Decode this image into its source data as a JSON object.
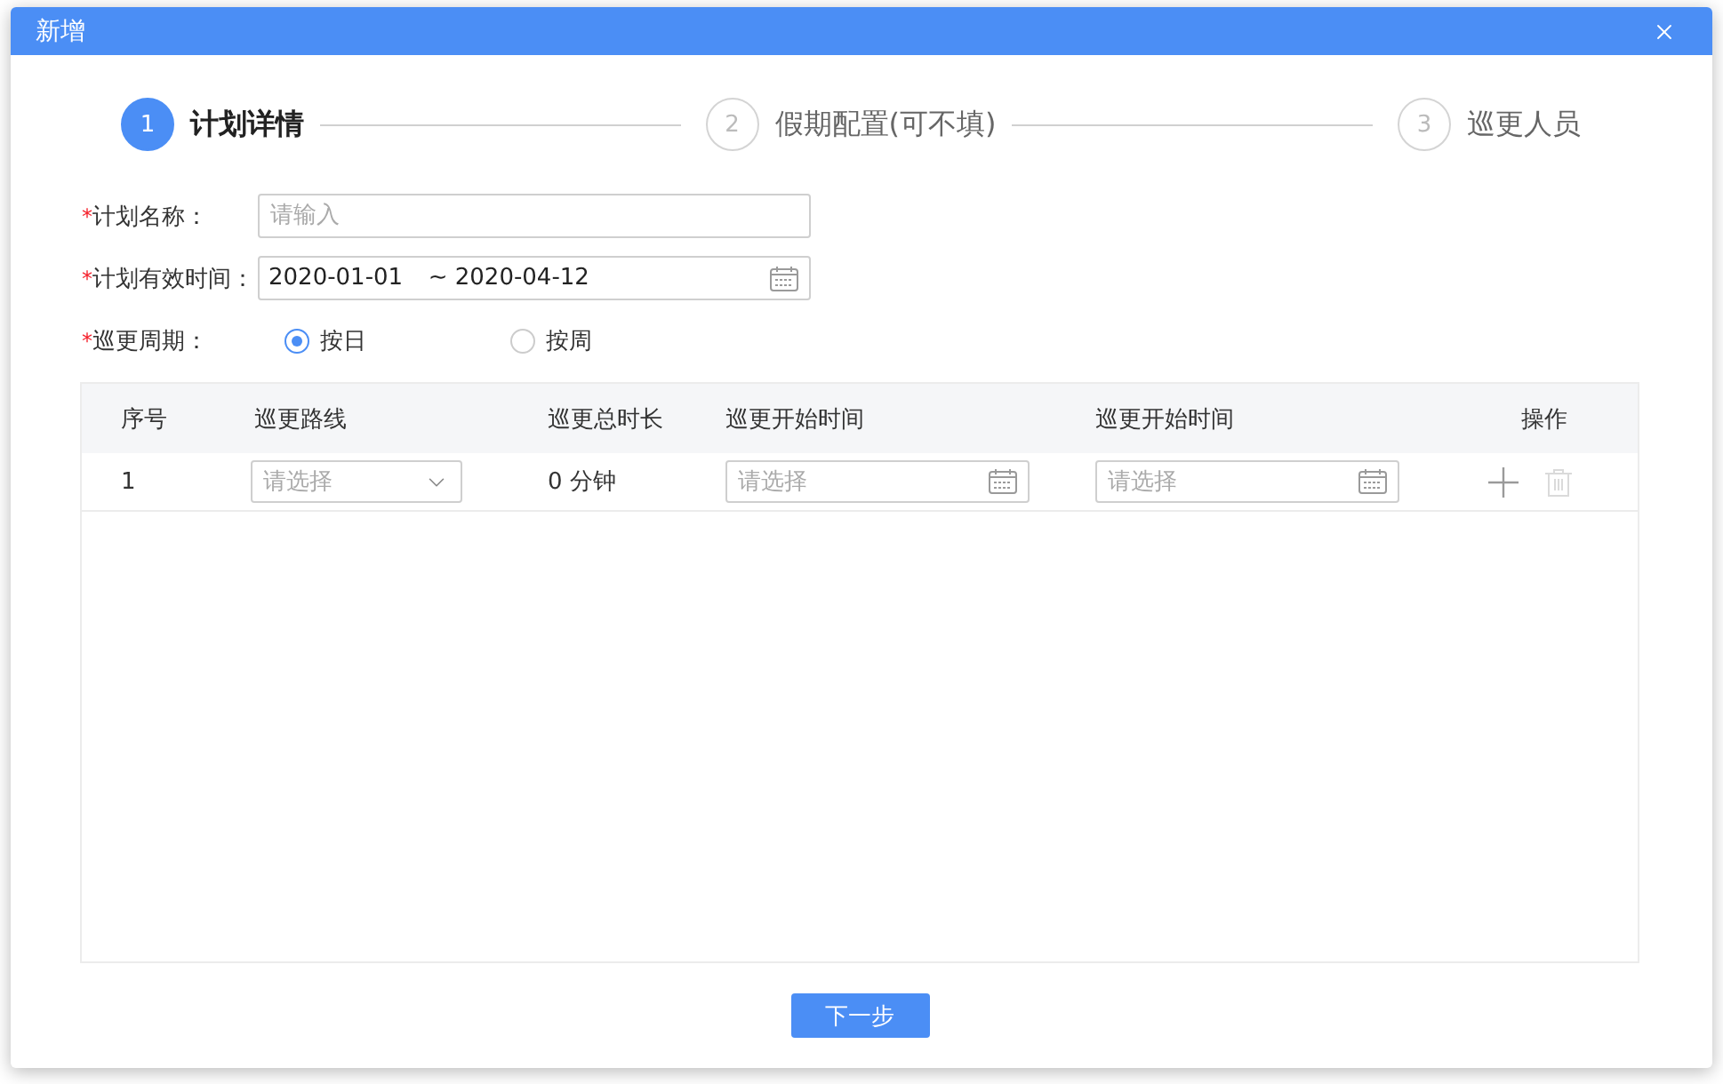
{
  "dialog": {
    "title": "新增"
  },
  "steps": [
    {
      "number": "1",
      "label": "计划详情",
      "selected": true
    },
    {
      "number": "2",
      "label": "假期配置(可不填)",
      "selected": false
    },
    {
      "number": "3",
      "label": "巡更人员",
      "selected": false
    }
  ],
  "form": {
    "fields": [
      {
        "kind": "text",
        "required_mark": "*",
        "label": "计划名称：",
        "placeholder": "请输入"
      },
      {
        "kind": "date_range",
        "required_mark": "*",
        "label": "计划有效时间：",
        "start": "2020-01-01",
        "separator": "~",
        "end": "2020-04-12"
      },
      {
        "kind": "radio",
        "required_mark": "*",
        "label": "巡更周期：",
        "options": [
          {
            "label": "按日",
            "selected": true
          },
          {
            "label": "按周",
            "selected": false
          }
        ]
      }
    ]
  },
  "table": {
    "columns": [
      "序号",
      "巡更路线",
      "巡更总时长",
      "巡更开始时间",
      "巡更开始时间",
      "操作"
    ],
    "rows": [
      {
        "cells": [
          {
            "kind": "text",
            "value": "1"
          },
          {
            "kind": "select",
            "placeholder": "请选择"
          },
          {
            "kind": "text",
            "value": "0 分钟"
          },
          {
            "kind": "date",
            "placeholder": "请选择"
          },
          {
            "kind": "date",
            "placeholder": "请选择"
          },
          {
            "kind": "actions",
            "actions": [
              {
                "kind": "add",
                "disabled": false
              },
              {
                "kind": "delete",
                "disabled": true
              }
            ]
          }
        ]
      }
    ]
  },
  "next_button": {
    "label": "下一步"
  }
}
